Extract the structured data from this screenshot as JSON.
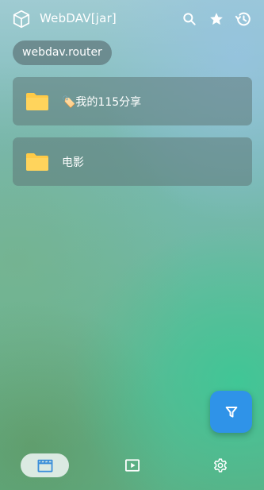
{
  "header": {
    "title": "WebDAV[jar]",
    "app_icon": "cube-icon",
    "actions": [
      {
        "icon": "search-icon"
      },
      {
        "icon": "star-icon"
      },
      {
        "icon": "history-icon"
      }
    ]
  },
  "breadcrumb": {
    "path": "webdav.router"
  },
  "files": [
    {
      "name": "🏷️我的115分享",
      "icon": "folder-icon"
    },
    {
      "name": "电影",
      "icon": "folder-icon"
    }
  ],
  "fab": {
    "icon": "filter-icon",
    "color": "#2f93e8"
  },
  "bottom_nav": [
    {
      "icon": "clapperboard-icon",
      "selected": true
    },
    {
      "icon": "play-icon",
      "selected": false
    },
    {
      "icon": "gear-icon",
      "selected": false
    }
  ],
  "colors": {
    "folder": "#ffcb47",
    "accent": "#2f93e8",
    "nav_icon_selected": "#3b8fd9"
  }
}
